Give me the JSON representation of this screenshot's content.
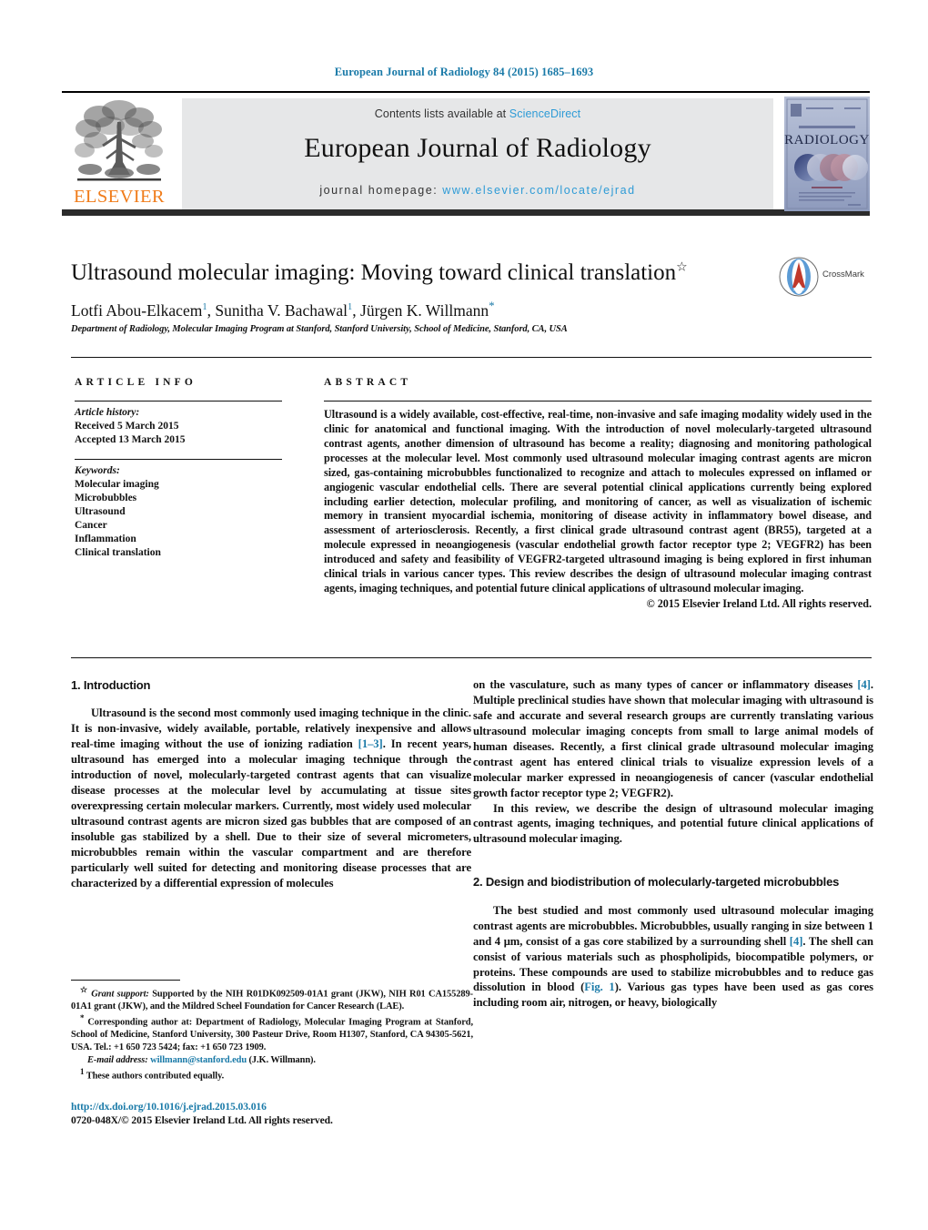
{
  "running_head": "European Journal of Radiology 84 (2015) 1685–1693",
  "masthead": {
    "publisher_name": "ELSEVIER",
    "contents_prefix": "Contents lists available at ",
    "contents_link": "ScienceDirect",
    "journal_title": "European Journal of Radiology",
    "homepage_prefix": "journal homepage: ",
    "homepage_url": "www.elsevier.com/locate/ejrad",
    "cover_title": "RADIOLOGY",
    "cover_supertitle": "EUROPEAN JOURNAL OF"
  },
  "article": {
    "title": "Ultrasound molecular imaging: Moving toward clinical translation",
    "title_marker": "☆",
    "authors": [
      {
        "name": "Lotfi Abou-Elkacem",
        "sup": "1",
        "sep": ", "
      },
      {
        "name": "Sunitha V. Bachawal",
        "sup": "1",
        "sep": ", "
      },
      {
        "name": "Jürgen K. Willmann",
        "sup": "*",
        "sep": ""
      }
    ],
    "affiliation": "Department of Radiology, Molecular Imaging Program at Stanford, Stanford University, School of Medicine, Stanford, CA, USA",
    "crossmark_label": "CrossMark"
  },
  "article_info": {
    "heading": "ARTICLE INFO",
    "history_label": "Article history:",
    "history": [
      "Received 5 March 2015",
      "Accepted 13 March 2015"
    ],
    "keywords_label": "Keywords:",
    "keywords": [
      "Molecular imaging",
      "Microbubbles",
      "Ultrasound",
      "Cancer",
      "Inflammation",
      "Clinical translation"
    ]
  },
  "abstract": {
    "heading": "ABSTRACT",
    "body": "Ultrasound is a widely available, cost-effective, real-time, non-invasive and safe imaging modality widely used in the clinic for anatomical and functional imaging. With the introduction of novel molecularly-targeted ultrasound contrast agents, another dimension of ultrasound has become a reality; diagnosing and monitoring pathological processes at the molecular level. Most commonly used ultrasound molecular imaging contrast agents are micron sized, gas-containing microbubbles functionalized to recognize and attach to molecules expressed on inflamed or angiogenic vascular endothelial cells. There are several potential clinical applications currently being explored including earlier detection, molecular profiling, and monitoring of cancer, as well as visualization of ischemic memory in transient myocardial ischemia, monitoring of disease activity in inflammatory bowel disease, and assessment of arteriosclerosis. Recently, a first clinical grade ultrasound contrast agent (BR55), targeted at a molecule expressed in neoangiogenesis (vascular endothelial growth factor receptor type 2; VEGFR2) has been introduced and safety and feasibility of VEGFR2-targeted ultrasound imaging is being explored in first inhuman clinical trials in various cancer types. This review describes the design of ultrasound molecular imaging contrast agents, imaging techniques, and potential future clinical applications of ultrasound molecular imaging.",
    "copyright": "© 2015 Elsevier Ireland Ltd. All rights reserved."
  },
  "body": {
    "section1_heading": "1. Introduction",
    "section1_p1_a": "Ultrasound is the second most commonly used imaging technique in the clinic. It is non-invasive, widely available, portable, relatively inexpensive and allows real-time imaging without the use of ionizing radiation ",
    "section1_p1_ref": "[1–3]",
    "section1_p1_b": ". In recent years, ultrasound has emerged into a molecular imaging technique through the introduction of novel, molecularly-targeted contrast agents that can visualize disease processes at the molecular level by accumulating at tissue sites overexpressing certain molecular markers. Currently, most widely used molecular ultrasound contrast agents are micron sized gas bubbles that are composed of an insoluble gas stabilized by a shell. Due to their size of several micrometers, microbubbles remain within the vascular compartment and are therefore particularly well suited for detecting and monitoring disease processes that are characterized by a differential expression of molecules",
    "section1_p1_cont_a": "on the vasculature, such as many types of cancer or inflammatory diseases ",
    "section1_p1_cont_ref": "[4]",
    "section1_p1_cont_b": ". Multiple preclinical studies have shown that molecular imaging with ultrasound is safe and accurate and several research groups are currently translating various ultrasound molecular imaging concepts from small to large animal models of human diseases. Recently, a first clinical grade ultrasound molecular imaging contrast agent has entered clinical trials to visualize expression levels of a molecular marker expressed in neoangiogenesis of cancer (vascular endothelial growth factor receptor type 2; VEGFR2).",
    "section1_p2": "In this review, we describe the design of ultrasound molecular imaging contrast agents, imaging techniques, and potential future clinical applications of ultrasound molecular imaging.",
    "section2_heading": "2. Design and biodistribution of molecularly-targeted microbubbles",
    "section2_p1_a": "The best studied and most commonly used ultrasound molecular imaging contrast agents are microbubbles. Microbubbles, usually ranging in size between 1 and 4 μm, consist of a gas core stabilized by a surrounding shell ",
    "section2_p1_ref1": "[4]",
    "section2_p1_b": ". The shell can consist of various materials such as phospholipids, biocompatible polymers, or proteins. These compounds are used to stabilize microbubbles and to reduce gas dissolution in blood (",
    "section2_p1_ref2": "Fig. 1",
    "section2_p1_c": "). Various gas types have been used as gas cores including room air, nitrogen, or heavy, biologically"
  },
  "footnotes": {
    "grant_mark": "☆",
    "grant_label": "Grant support:",
    "grant_text": " Supported by the NIH R01DK092509-01A1 grant (JKW), NIH R01 CA155289-01A1 grant (JKW), and the Mildred Scheel Foundation for Cancer Research (LAE).",
    "corresponding_mark": "*",
    "corresponding_text": " Corresponding author at: Department of Radiology, Molecular Imaging Program at Stanford, School of Medicine, Stanford University, 300 Pasteur Drive, Room H1307, Stanford, CA 94305-5621, USA. Tel.: +1 650 723 5424; fax: +1 650 723 1909.",
    "email_label": "E-mail address:",
    "email_address": "willmann@stanford.edu",
    "email_suffix": " (J.K. Willmann).",
    "equal_mark": "1",
    "equal_text": " These authors contributed equally."
  },
  "footer": {
    "doi": "http://dx.doi.org/10.1016/j.ejrad.2015.03.016",
    "issn": "0720-048X/© 2015 Elsevier Ireland Ltd. All rights reserved."
  },
  "colors": {
    "link_blue": "#1a7aa8",
    "science_direct_blue": "#2e9bd6",
    "elsevier_orange": "#f07c1a",
    "band_gray": "#e6e7e8"
  }
}
